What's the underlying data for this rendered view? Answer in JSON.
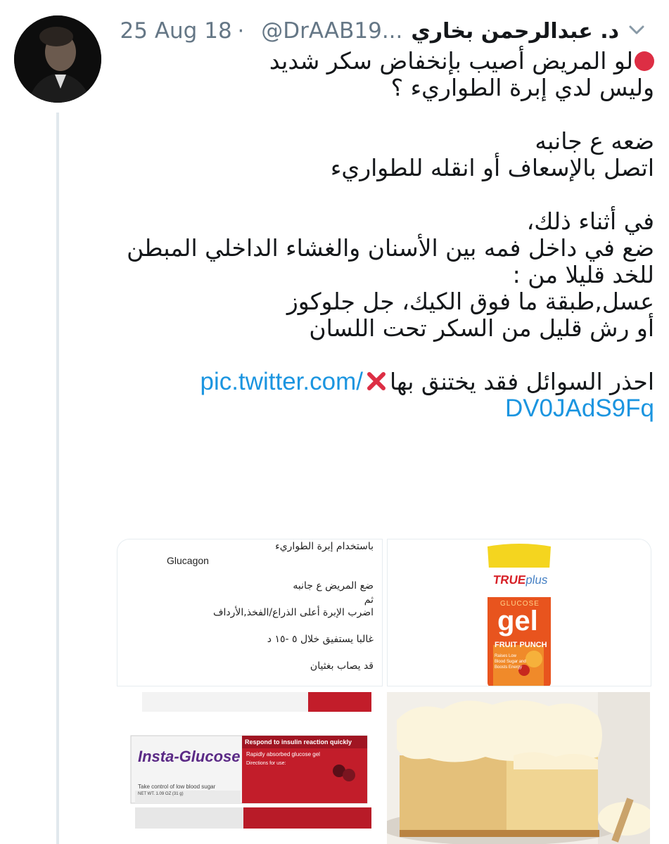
{
  "tweet": {
    "author": {
      "display_name": "د. عبدالرحمن بخاري",
      "handle": "@DrAAB19...",
      "avatar_icon": "profile-avatar"
    },
    "separator": "·",
    "date": "25 Aug 18",
    "menu_icon": "chevron-down-icon",
    "lines": [
      "لو المريض أصيب بإنخفاض سكر شديد",
      "وليس لدي إبرة الطواريء ؟",
      "",
      "ضعه ع جانبه",
      "اتصل بالإسعاف أو انقله للطواريء",
      "",
      "في أثناء ذلك،",
      "ضع في داخل فمه بين الأسنان والغشاء الداخلي المبطن",
      "للخد قليلا من :",
      "عسل,طبقة ما فوق الكيك، جل جلوكوز",
      "أو رش قليل من السكر تحت اللسان",
      "",
      "احذر السوائل فقد يختنق بها"
    ],
    "red_dot_emoji": "large-red-circle",
    "cross_emoji": "cross-mark",
    "link_part1": "pic.twitter.com/",
    "link_part2": "DV0JAdS9Fq",
    "accent_color": "#1b95e0"
  },
  "media": {
    "tile1": {
      "lines": [
        "باستخدام إبرة الطواريء",
        "ضع المريض ع جانبه",
        "ثم",
        "اضرب الإبرة أعلى الذراع/الفخذ,الأرداف",
        "غالبا يستفيق خلال ٥ -١٥ د",
        "قد يصاب بغثيان"
      ],
      "latin_label": "Glucagon"
    },
    "tile2": {
      "brand": "TRUE",
      "brand_plus": "plus",
      "product_small": "GLUCOSE",
      "product": "gel",
      "flavor": "FRUIT PUNCH",
      "note": "Raises Low Blood Sugar and Boosts Energy"
    },
    "tile3": {
      "brand": "Insta-Glucose",
      "tagline": "Take control of low blood sugar",
      "header": "Respond to insulin reaction quickly",
      "subheader": "Rapidly absorbed glucose gel",
      "directions_title": "Directions for use:",
      "net_weight": "NET WT. 1.09 OZ (31 g)"
    },
    "tile4": {
      "subject": "frosted vanilla cake slice"
    }
  }
}
